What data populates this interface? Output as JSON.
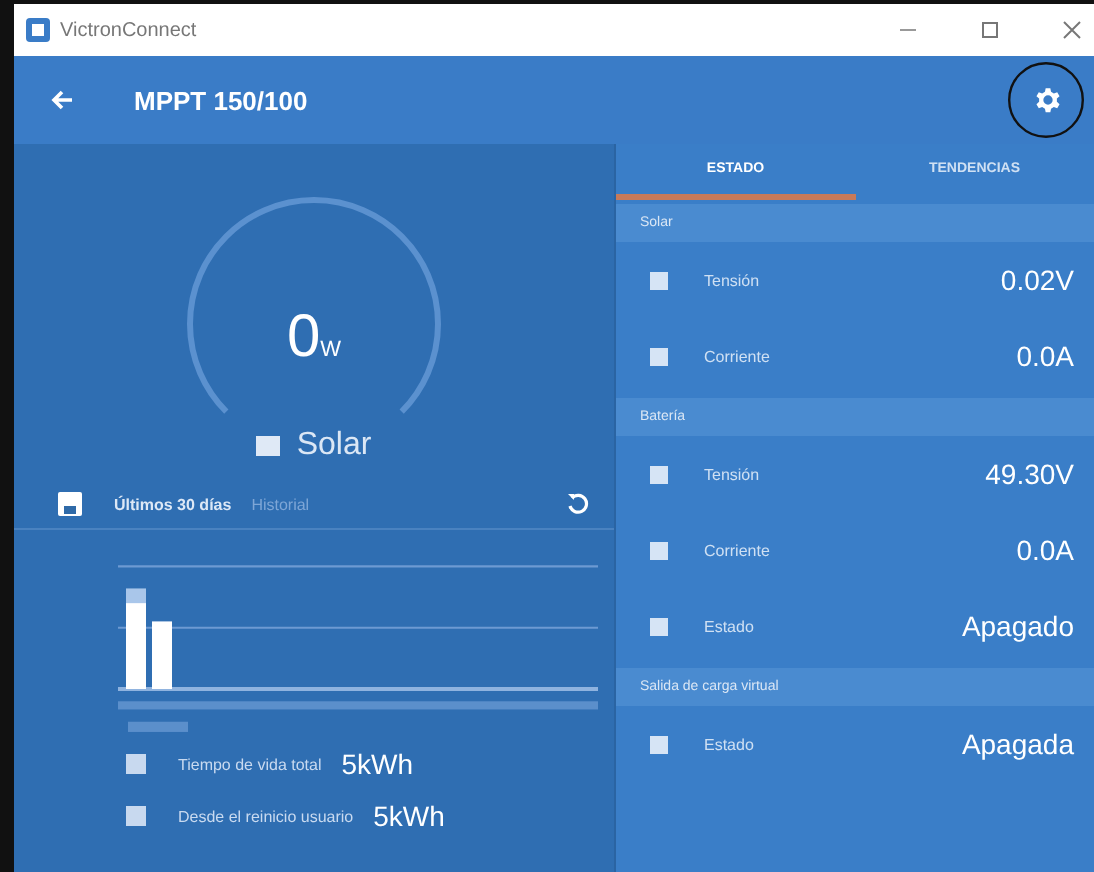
{
  "window": {
    "title": "VictronConnect"
  },
  "app_bar": {
    "title": "MPPT 150/100",
    "highlighted_settings": true
  },
  "gauge": {
    "value": "0",
    "unit": "W",
    "label": "Solar"
  },
  "history": {
    "title": "Últimos 30 días",
    "subtitle": "Historial"
  },
  "totals": [
    {
      "label": "Tiempo de vida total",
      "value": "5kWh"
    },
    {
      "label": "Desde el reinicio usuario",
      "value": "5kWh"
    }
  ],
  "tabs": [
    {
      "label": "ESTADO",
      "selected": true
    },
    {
      "label": "TENDENCIAS",
      "selected": false
    }
  ],
  "sections": [
    {
      "title": "Solar",
      "rows": [
        {
          "label": "Tensión",
          "value": "0.02V"
        },
        {
          "label": "Corriente",
          "value": "0.0A"
        }
      ]
    },
    {
      "title": "Batería",
      "rows": [
        {
          "label": "Tensión",
          "value": "49.30V"
        },
        {
          "label": "Corriente",
          "value": "0.0A"
        },
        {
          "label": "Estado",
          "value": "Apagado"
        }
      ]
    },
    {
      "title": "Salida de carga virtual",
      "rows": [
        {
          "label": "Estado",
          "value": "Apagada"
        }
      ]
    }
  ]
}
